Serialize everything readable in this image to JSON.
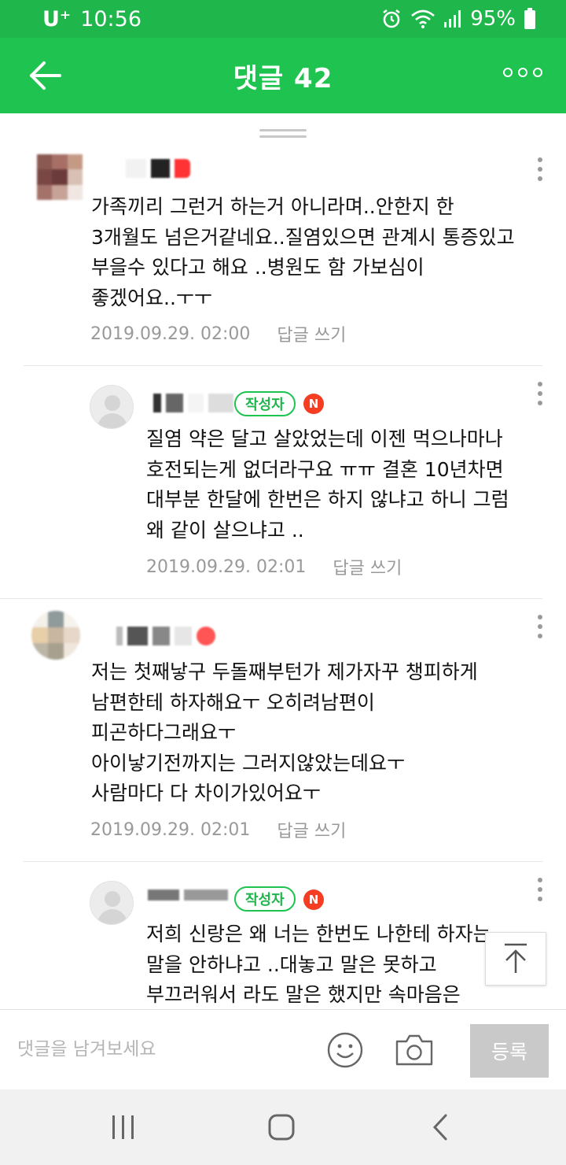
{
  "status_bar": {
    "carrier": "U⁺",
    "time": "10:56",
    "battery": "95%",
    "icons": [
      "alarm-icon",
      "wifi-icon",
      "signal-icon",
      "battery-icon"
    ]
  },
  "header": {
    "title": "댓글 42",
    "back_icon": "arrow-left-icon",
    "more_icon": "more-horizontal-icon"
  },
  "comments": [
    {
      "is_reply": false,
      "is_author": false,
      "lines": [
        "가족끼리 그런거 하는거 아니라며..안한지 한",
        "3개월도 넘은거같네요..질염있으면 관계시 통증있고",
        "부을수 있다고 해요 ..병원도 함 가보심이",
        "좋겠어요..ㅜㅜ"
      ],
      "date": "2019.09.29. 02:00",
      "reply_label": "답글 쓰기"
    },
    {
      "is_reply": true,
      "is_author": true,
      "author_badge": "작성자",
      "lines": [
        "질염 약은 달고 살았었는데 이젠 먹으나마나",
        "호전되는게 없더라구요 ㅠㅠ 결혼 10년차면",
        "대부분 한달에 한번은 하지 않냐고 하니 그럼",
        "왜 같이 살으냐고 .."
      ],
      "date": "2019.09.29. 02:01",
      "reply_label": "답글 쓰기"
    },
    {
      "is_reply": false,
      "is_author": false,
      "lines": [
        "저는 첫째낳구 두돌째부턴가 제가자꾸 챙피하게",
        "남편한테 하자해요ㅜ 오히려남편이",
        "피곤하다그래요ㅜ",
        "아이낳기전까지는 그러지않았는데요ㅜ",
        "사람마다 다 차이가있어요ㅜ"
      ],
      "date": "2019.09.29. 02:01",
      "reply_label": "답글 쓰기"
    },
    {
      "is_reply": true,
      "is_author": true,
      "author_badge": "작성자",
      "lines": [
        "저희 신랑은 왜 너는 한번도 나한테 하자는",
        "말을 안하냐고 ..대놓고 말은 못하고",
        "부끄러워서 라도 말은 했지만 속마음은"
      ]
    }
  ],
  "input": {
    "placeholder": "댓글을 남겨보세요",
    "value": "",
    "submit_label": "등록",
    "emoji_icon": "smiley-icon",
    "camera_icon": "camera-icon"
  },
  "nav": {
    "icons": [
      "recent-apps-icon",
      "home-icon",
      "back-icon"
    ]
  },
  "colors": {
    "brand_green": "#1fc450",
    "status_green": "#1fb64c",
    "badge_red": "#f43d22"
  }
}
